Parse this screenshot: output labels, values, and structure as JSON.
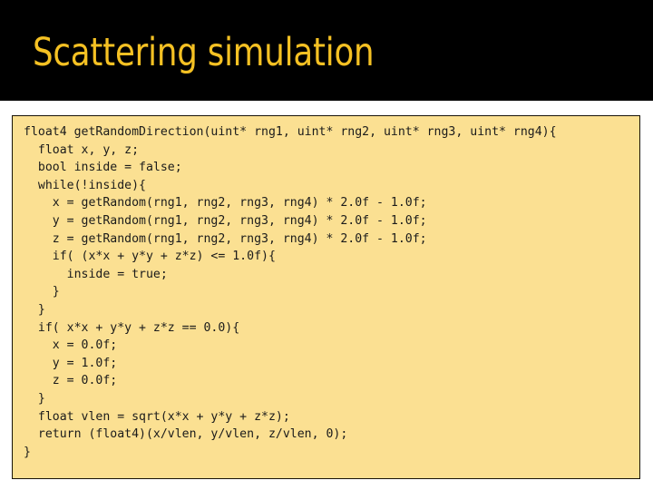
{
  "slide": {
    "title": "Scattering simulation",
    "title_color": "#F5C123",
    "title_band_color": "#000000",
    "background_color": "#FFFFFF"
  },
  "code_panel": {
    "background_color": "#FBE092",
    "border_color": "#181308",
    "language": "OpenCL C",
    "lines": [
      "float4 getRandomDirection(uint* rng1, uint* rng2, uint* rng3, uint* rng4){",
      "  float x, y, z;",
      "  bool inside = false;",
      "  while(!inside){",
      "    x = getRandom(rng1, rng2, rng3, rng4) * 2.0f - 1.0f;",
      "    y = getRandom(rng1, rng2, rng3, rng4) * 2.0f - 1.0f;",
      "    z = getRandom(rng1, rng2, rng3, rng4) * 2.0f - 1.0f;",
      "    if( (x*x + y*y + z*z) <= 1.0f){",
      "      inside = true;",
      "    }",
      "  }",
      "  if( x*x + y*y + z*z == 0.0){",
      "    x = 0.0f;",
      "    y = 1.0f;",
      "    z = 0.0f;",
      "  }",
      "  float vlen = sqrt(x*x + y*y + z*z);",
      "  return (float4)(x/vlen, y/vlen, z/vlen, 0);",
      "}"
    ],
    "text": "float4 getRandomDirection(uint* rng1, uint* rng2, uint* rng3, uint* rng4){\n  float x, y, z;\n  bool inside = false;\n  while(!inside){\n    x = getRandom(rng1, rng2, rng3, rng4) * 2.0f - 1.0f;\n    y = getRandom(rng1, rng2, rng3, rng4) * 2.0f - 1.0f;\n    z = getRandom(rng1, rng2, rng3, rng4) * 2.0f - 1.0f;\n    if( (x*x + y*y + z*z) <= 1.0f){\n      inside = true;\n    }\n  }\n  if( x*x + y*y + z*z == 0.0){\n    x = 0.0f;\n    y = 1.0f;\n    z = 0.0f;\n  }\n  float vlen = sqrt(x*x + y*y + z*z);\n  return (float4)(x/vlen, y/vlen, z/vlen, 0);\n}"
  }
}
